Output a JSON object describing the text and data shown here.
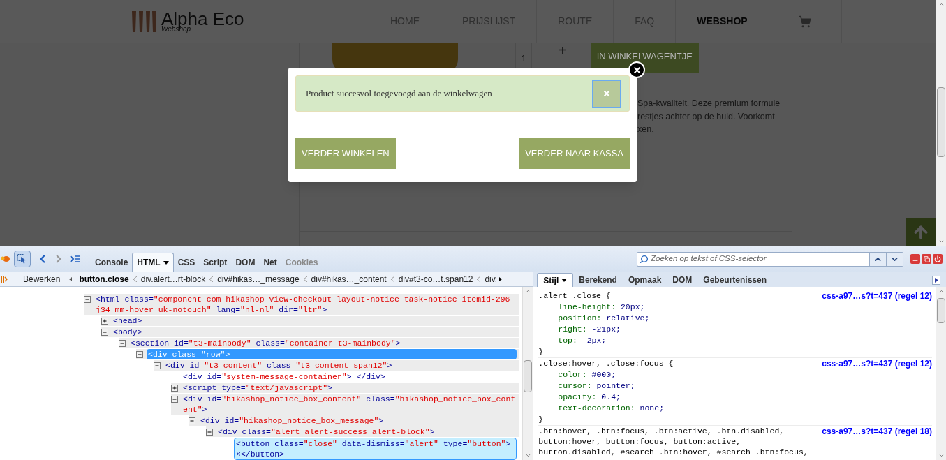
{
  "site": {
    "logo_title": "Alpha Eco",
    "logo_subtitle": "Webshop",
    "nav": [
      {
        "label": "HOME",
        "selected": false
      },
      {
        "label": "PRIJSLIJST",
        "selected": false
      },
      {
        "label": "ROUTE",
        "selected": false
      },
      {
        "label": "FAQ",
        "selected": false
      },
      {
        "label": "WEBSHOP",
        "selected": true
      }
    ],
    "quantity": "1",
    "plus": "+",
    "add_button": "IN WINKELWAGENTJE",
    "description": [
      "Spa-kwaliteit. Deze premium formule",
      "restjes achter op de huid. Voorkomt",
      "xen."
    ]
  },
  "modal": {
    "message": "Product succesvol toegevoegd aan de winkelwagen",
    "buttons": [
      "VERDER WINKELEN",
      "VERDER NAAR KASSA"
    ]
  },
  "devtools": {
    "tabs": [
      {
        "label": "Console",
        "selected": false,
        "disabled": false
      },
      {
        "label": "HTML",
        "selected": true,
        "disabled": false
      },
      {
        "label": "CSS",
        "selected": false,
        "disabled": false
      },
      {
        "label": "Script",
        "selected": false,
        "disabled": false
      },
      {
        "label": "DOM",
        "selected": false,
        "disabled": false
      },
      {
        "label": "Net",
        "selected": false,
        "disabled": false
      },
      {
        "label": "Cookies",
        "selected": false,
        "disabled": true
      }
    ],
    "search": {
      "placeholder": "Zoeken op tekst of CSS-selector"
    },
    "edit_button": "Bewerken",
    "breadcrumbs": [
      {
        "label": "button.close",
        "selected": true
      },
      {
        "label": "div.alert…rt-block",
        "selected": false
      },
      {
        "label": "div#hikas…_message",
        "selected": false
      },
      {
        "label": "div#hikas…_content",
        "selected": false
      },
      {
        "label": "div#t3-co…t.span12",
        "selected": false
      },
      {
        "label": "div.",
        "selected": false
      }
    ],
    "tree": [
      {
        "text": "<html class=\"component com_hikashop view-checkout layout-notice task-notice itemid-296 j34 mm-hover uk-notouch\" lang=\"nl-nl\" dir=\"ltr\">",
        "expanded": true,
        "selected": false,
        "hovered": false,
        "children": [
          {
            "text": "<head>",
            "expanded": false,
            "selected": false,
            "hovered": false
          },
          {
            "text": "<body>",
            "expanded": true,
            "selected": false,
            "hovered": false,
            "children": [
              {
                "text": "<section id=\"t3-mainbody\" class=\"container t3-mainbody\">",
                "expanded": true,
                "selected": false,
                "hovered": false,
                "children": [
                  {
                    "text": "<div class=\"row\">",
                    "expanded": true,
                    "selected": true,
                    "hovered": false,
                    "children": [
                      {
                        "text": "<div id=\"t3-content\" class=\"t3-content span12\">",
                        "expanded": true,
                        "selected": false,
                        "hovered": false,
                        "children": [
                          {
                            "text": "<div id=\"system-message-container\">  </div>",
                            "selected": false,
                            "hovered": false
                          },
                          {
                            "text": "<script type=\"text/javascript\">",
                            "expanded": false,
                            "selected": false,
                            "hovered": false
                          },
                          {
                            "text": "<div id=\"hikashop_notice_box_content\" class=\"hikashop_notice_box_content\">",
                            "expanded": true,
                            "selected": false,
                            "hovered": false,
                            "children": [
                              {
                                "text": "<div id=\"hikashop_notice_box_message\">",
                                "expanded": true,
                                "selected": false,
                                "hovered": false,
                                "children": [
                                  {
                                    "text": "<div class=\"alert alert-success alert-block\">",
                                    "expanded": true,
                                    "selected": false,
                                    "hovered": false,
                                    "children": [
                                      {
                                        "text": "<button class=\"close\" data-dismiss=\"alert\" type=\"button\">×</button>",
                                        "selected": false,
                                        "hovered": true
                                      }
                                    ]
                                  }
                                ]
                              }
                            ]
                          }
                        ]
                      }
                    ]
                  }
                ]
              }
            ]
          }
        ]
      }
    ],
    "side_tabs": [
      {
        "label": "Stijl",
        "selected": true
      },
      {
        "label": "Berekend",
        "selected": false
      },
      {
        "label": "Opmaak",
        "selected": false
      },
      {
        "label": "DOM",
        "selected": false
      },
      {
        "label": "Gebeurtenissen",
        "selected": false
      }
    ],
    "rules": [
      {
        "selector": ".alert .close {",
        "source": "css-a97…s?t=437 (regel 12)",
        "declarations": [
          "line-height: 20px;",
          "position: relative;",
          "right: -21px;",
          "top: -2px;"
        ],
        "end": "}"
      },
      {
        "selector": ".close:hover, .close:focus {",
        "source": "css-a97…s?t=437 (regel 12)",
        "declarations": [
          "color: #000;",
          "cursor: pointer;",
          "opacity: 0.4;",
          "text-decoration: none;"
        ],
        "end": "}"
      },
      {
        "selector": ".btn:hover, .btn:focus, .btn:active, .btn.disabled, button:hover, button:focus, button:active, button.disabled, #search .btn:hover, #search .btn:focus,",
        "source": "css-a97…s?t=437 (regel 18)"
      }
    ]
  }
}
